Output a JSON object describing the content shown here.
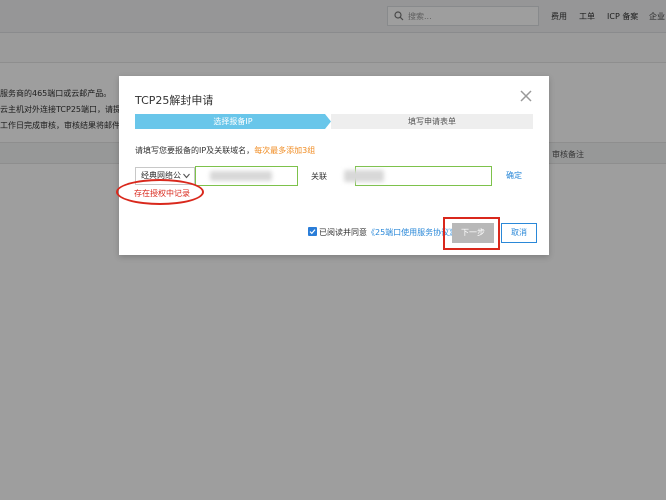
{
  "topbar": {
    "search_placeholder": "搜索...",
    "links": [
      "费用",
      "工单",
      "ICP 备案",
      "企业"
    ]
  },
  "background": {
    "notice_lines": [
      "服务商的465端口或云邮产品。",
      "云主机对外连接TCP25端口，请提交",
      "工作日完成审核，审核结果将邮件通"
    ],
    "table_column": "审核备注"
  },
  "dialog": {
    "title": "TCP25解封申请",
    "steps": [
      "选择报备IP",
      "填写申请表单"
    ],
    "instruction": "请填写您要报备的IP及关联域名，",
    "instruction_highlight": "每次最多添加3组",
    "network_select": "经典网络公",
    "relation_label": "关联",
    "confirm_label": "确定",
    "auth_record_link": "存在授权中记录",
    "agree_prefix": "已阅读并同意",
    "agree_link": "《25端口使用服务协议》",
    "next_label": "下一步",
    "cancel_label": "取消",
    "accent_color": "#69c6ea",
    "annotation_color": "#d9281c"
  }
}
